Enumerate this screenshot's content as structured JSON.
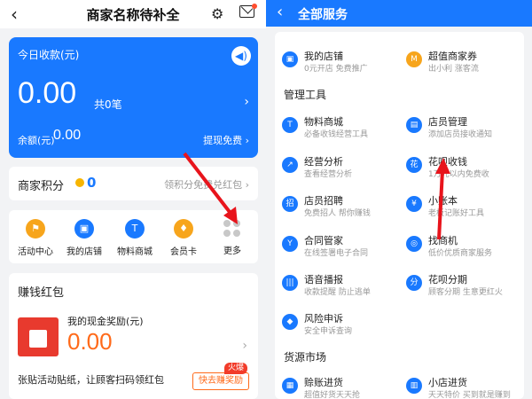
{
  "left": {
    "title": "商家名称待补全",
    "today": {
      "label": "今日收款(元)",
      "amount": "0.00",
      "count": "共0笔",
      "balance_label": "余额(元)",
      "balance": "0.00",
      "withdraw": "提现免费"
    },
    "points": {
      "label": "商家积分",
      "value": "0",
      "hint": "领积分免费兑红包"
    },
    "quick": [
      {
        "label": "活动中心",
        "icon": "flag-icon",
        "color": "#f7a51c"
      },
      {
        "label": "我的店铺",
        "icon": "shop-icon",
        "color": "#1979ff"
      },
      {
        "label": "物料商城",
        "icon": "mall-icon",
        "color": "#1979ff"
      },
      {
        "label": "会员卡",
        "icon": "card-icon",
        "color": "#f7a51c"
      },
      {
        "label": "更多",
        "icon": "more-icon",
        "color": "#c8c8c8"
      }
    ],
    "money": {
      "title": "赚钱红包",
      "reward_label": "我的现金奖励(元)",
      "reward": "0.00",
      "footer": "张贴活动贴纸，让顾客扫码领红包",
      "button": "快去赚奖励",
      "hot": "火爆"
    }
  },
  "right": {
    "title": "全部服务",
    "sections": {
      "tools": "管理工具",
      "market": "货源市场"
    },
    "services": {
      "shop": {
        "name": "我的店铺",
        "desc": "0元开店 免费推广"
      },
      "coupon": {
        "name": "超值商家券",
        "desc": "出小利 涨客流"
      },
      "mall": {
        "name": "物料商城",
        "desc": "必备收钱经营工具"
      },
      "staff": {
        "name": "店员管理",
        "desc": "添加店员接收通知"
      },
      "analysis": {
        "name": "经营分析",
        "desc": "查看经营分析"
      },
      "huabei": {
        "name": "花呗收钱",
        "desc": "1万元以内免费收"
      },
      "recruit": {
        "name": "店员招聘",
        "desc": "免费招人 帮你赚钱"
      },
      "ledger": {
        "name": "小账本",
        "desc": "老板记账好工具"
      },
      "contract": {
        "name": "合同管家",
        "desc": "在线签署电子合同"
      },
      "findbiz": {
        "name": "找商机",
        "desc": "低价优质商家服务"
      },
      "voice": {
        "name": "语音播报",
        "desc": "收款提醒 防止逃单"
      },
      "installment": {
        "name": "花呗分期",
        "desc": "顾客分期 生意更红火"
      },
      "risk": {
        "name": "风险申诉",
        "desc": "安全申诉查询"
      },
      "credit": {
        "name": "赊账进货",
        "desc": "超值好货天天抢"
      },
      "store": {
        "name": "小店进货",
        "desc": "天天特价 买到就是赚到"
      }
    },
    "accent": "#1979ff"
  },
  "annotation_color": "#e8141c"
}
